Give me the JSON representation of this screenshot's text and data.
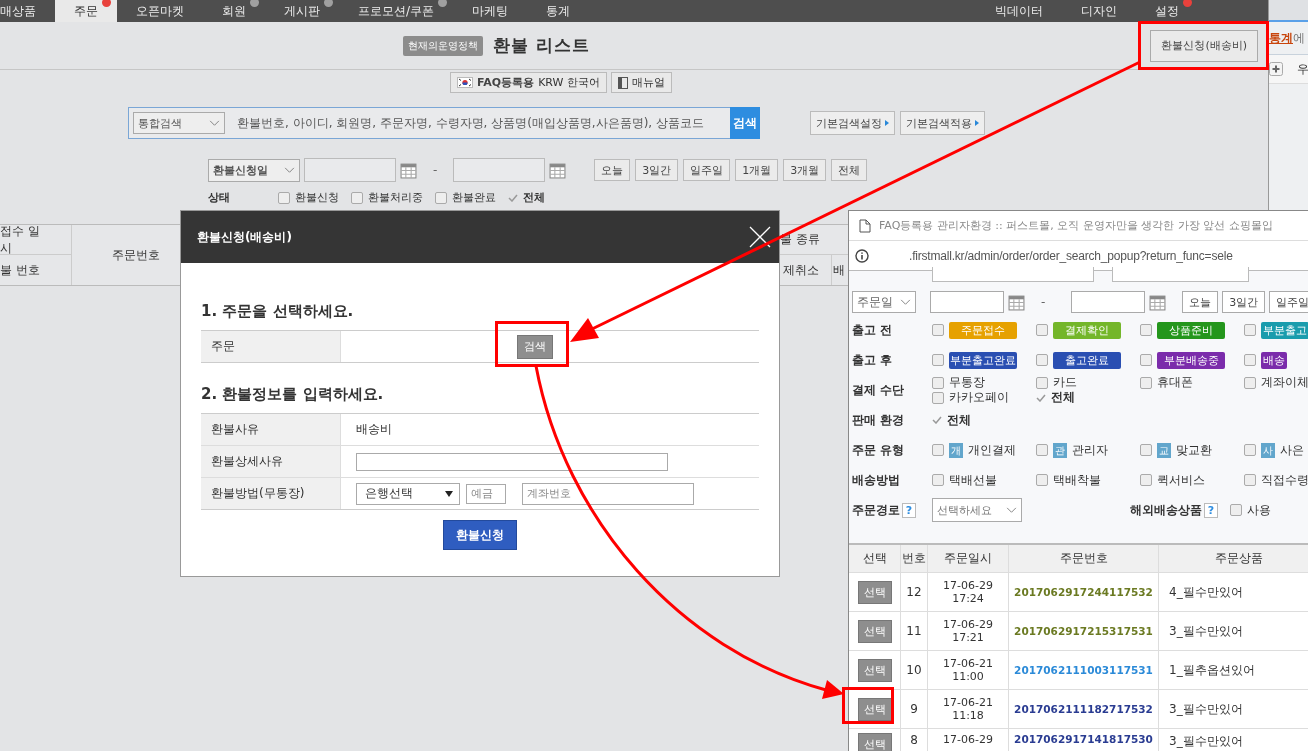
{
  "nav": {
    "items": [
      {
        "label": "매상품",
        "selected": false
      },
      {
        "label": "주문",
        "selected": true,
        "color": "#e8413c"
      },
      {
        "label": "오픈마켓",
        "selected": false
      },
      {
        "label": "회원",
        "selected": false,
        "color": "#a0a0a0"
      },
      {
        "label": "게시판",
        "selected": false,
        "color": "#a0a0a0"
      },
      {
        "label": "프로모션/쿠폰",
        "selected": false,
        "color": "#a0a0a0"
      },
      {
        "label": "마케팅",
        "selected": false
      },
      {
        "label": "통계",
        "selected": false
      }
    ],
    "right_items": [
      {
        "label": "빅데이터"
      },
      {
        "label": "디자인"
      },
      {
        "label": "설정",
        "color": "#e8413c"
      }
    ]
  },
  "header": {
    "policy_badge": "현재의운영정책",
    "title": "환불 리스트",
    "action_button": "환불신청(배송비)"
  },
  "toolbar": {
    "faq_label": "FAQ등록용",
    "currency": "KRW 한국어",
    "manual_button": "매뉴얼"
  },
  "search": {
    "type_select": "통합검색",
    "placeholder": "환불번호, 아이디, 회원명, 주문자명, 수령자명, 상품명(매입상품명,사은품명), 상품코드",
    "button": "검색",
    "presets": [
      "기본검색설정",
      "기본검색적용"
    ]
  },
  "date_filter": {
    "select": "환불신청일",
    "separator": "-",
    "quick_buttons": [
      "오늘",
      "3일간",
      "일주일",
      "1개월",
      "3개월",
      "전체"
    ]
  },
  "status_filter": {
    "label": "상태",
    "options": [
      {
        "label": "환불신청",
        "checked": false
      },
      {
        "label": "환불처리중",
        "checked": false
      },
      {
        "label": "환불완료",
        "checked": false
      },
      {
        "label": "전체",
        "checked": true
      }
    ]
  },
  "table": {
    "left_top": "접수 일시",
    "left_bottom": "불 번호",
    "order_column": "주문번호",
    "right_top": "불 종류",
    "right_bottom": [
      "제취소",
      "배"
    ]
  },
  "side_window": {
    "link": "통계",
    "text": "에",
    "column_text": "우"
  },
  "dialog": {
    "title": "환불신청(배송비)",
    "section1": "1. 주문을 선택하세요.",
    "order_label": "주문",
    "order_button": "검색",
    "section2": "2. 환불정보를 입력하세요.",
    "rows": [
      {
        "kind": "text",
        "label": "환불사유",
        "value": "배송비"
      },
      {
        "kind": "input",
        "label": "환불상세사유"
      },
      {
        "kind": "bank",
        "label": "환불방법(무통장)",
        "bank_select": "은행선택",
        "holder_placeholder": "예금",
        "account_placeholder": "계좌번호"
      }
    ],
    "submit": "환불신청"
  },
  "popup": {
    "title": "FAQ등록용 관리자환경 :: 퍼스트몰, 오직 운영자만을 생각한 가장 앞선 쇼핑몰입",
    "url": ".firstmall.kr/admin/order/order_search_popup?return_func=sele",
    "filters": [
      {
        "kind": "date",
        "select": "주문일",
        "separator": "-",
        "buttons": [
          "오늘",
          "3일간",
          "일주일"
        ]
      },
      {
        "kind": "badges",
        "label": "출고 전",
        "options": [
          {
            "label": "주문접수",
            "checked": false,
            "color": "#e6a100"
          },
          {
            "label": "결제확인",
            "checked": false,
            "color": "#74b62a"
          },
          {
            "label": "상품준비",
            "checked": false,
            "color": "#24961c"
          },
          {
            "label": "부분출고",
            "checked": false,
            "color": "#1a9cad"
          }
        ]
      },
      {
        "kind": "badges",
        "label": "출고 후",
        "options": [
          {
            "label": "부분출고완료",
            "checked": false,
            "color": "#2a4fb2"
          },
          {
            "label": "출고완료",
            "checked": false,
            "color": "#2a4fb2"
          },
          {
            "label": "부분배송중",
            "checked": false,
            "color": "#7b2cab"
          },
          {
            "label": "배송",
            "checked": false,
            "color": "#7b2cab"
          }
        ]
      },
      {
        "kind": "checks",
        "label": "결제 수단",
        "options": [
          {
            "label": "무통장",
            "checked": false
          },
          {
            "label": "카드",
            "checked": false
          },
          {
            "label": "휴대폰",
            "checked": false
          },
          {
            "label": "계좌이체",
            "checked": false
          },
          {
            "label": "카카오페이",
            "checked": false
          },
          {
            "label": "전체",
            "checked": true
          }
        ]
      },
      {
        "kind": "checks",
        "label": "판매 환경",
        "options": [
          {
            "label": "전체",
            "checked": true
          }
        ]
      },
      {
        "kind": "types",
        "label": "주문 유형",
        "options": [
          {
            "icon": "개",
            "label": "개인결제",
            "checked": false
          },
          {
            "icon": "관",
            "label": "관리자",
            "checked": false
          },
          {
            "icon": "교",
            "label": "맞교환",
            "checked": false
          },
          {
            "icon": "사",
            "label": "사은",
            "checked": false
          }
        ]
      },
      {
        "kind": "checks",
        "label": "배송방법",
        "options": [
          {
            "label": "택배선불",
            "checked": false
          },
          {
            "label": "택배착불",
            "checked": false
          },
          {
            "label": "퀵서비스",
            "checked": false
          },
          {
            "label": "직접수령",
            "checked": false
          }
        ]
      },
      {
        "kind": "route",
        "label": "주문경로",
        "help": "?",
        "select": "선택하세요",
        "overseas_label": "해외배송상품",
        "overseas_help": "?",
        "option": {
          "label": "사용",
          "checked": false
        }
      }
    ],
    "columns": [
      "선택",
      "번호",
      "주문일시",
      "주문번호",
      "주문상품"
    ],
    "rows": [
      {
        "button": "선택",
        "no": "12",
        "date": "17-06-29",
        "time": "17:24",
        "order_no": "2017062917244117532",
        "color": "#6b7a22",
        "product": "4_필수만있어"
      },
      {
        "button": "선택",
        "no": "11",
        "date": "17-06-29",
        "time": "17:21",
        "order_no": "2017062917215317531",
        "color": "#6b7a22",
        "product": "3_필수만있어"
      },
      {
        "button": "선택",
        "no": "10",
        "date": "17-06-21",
        "time": "11:00",
        "order_no": "2017062111003117531",
        "color": "#2b8ad8",
        "product": "1_필추옵션있어"
      },
      {
        "button": "선택",
        "no": "9",
        "date": "17-06-21",
        "time": "11:18",
        "order_no": "2017062111182717532",
        "color": "#2a3c92",
        "product": "3_필수만있어"
      },
      {
        "button": "선택",
        "no": "8",
        "date": "17-06-29",
        "order_no": "2017062917141817530",
        "color": "#2a3c92",
        "product": "3_필수만있어"
      }
    ]
  }
}
